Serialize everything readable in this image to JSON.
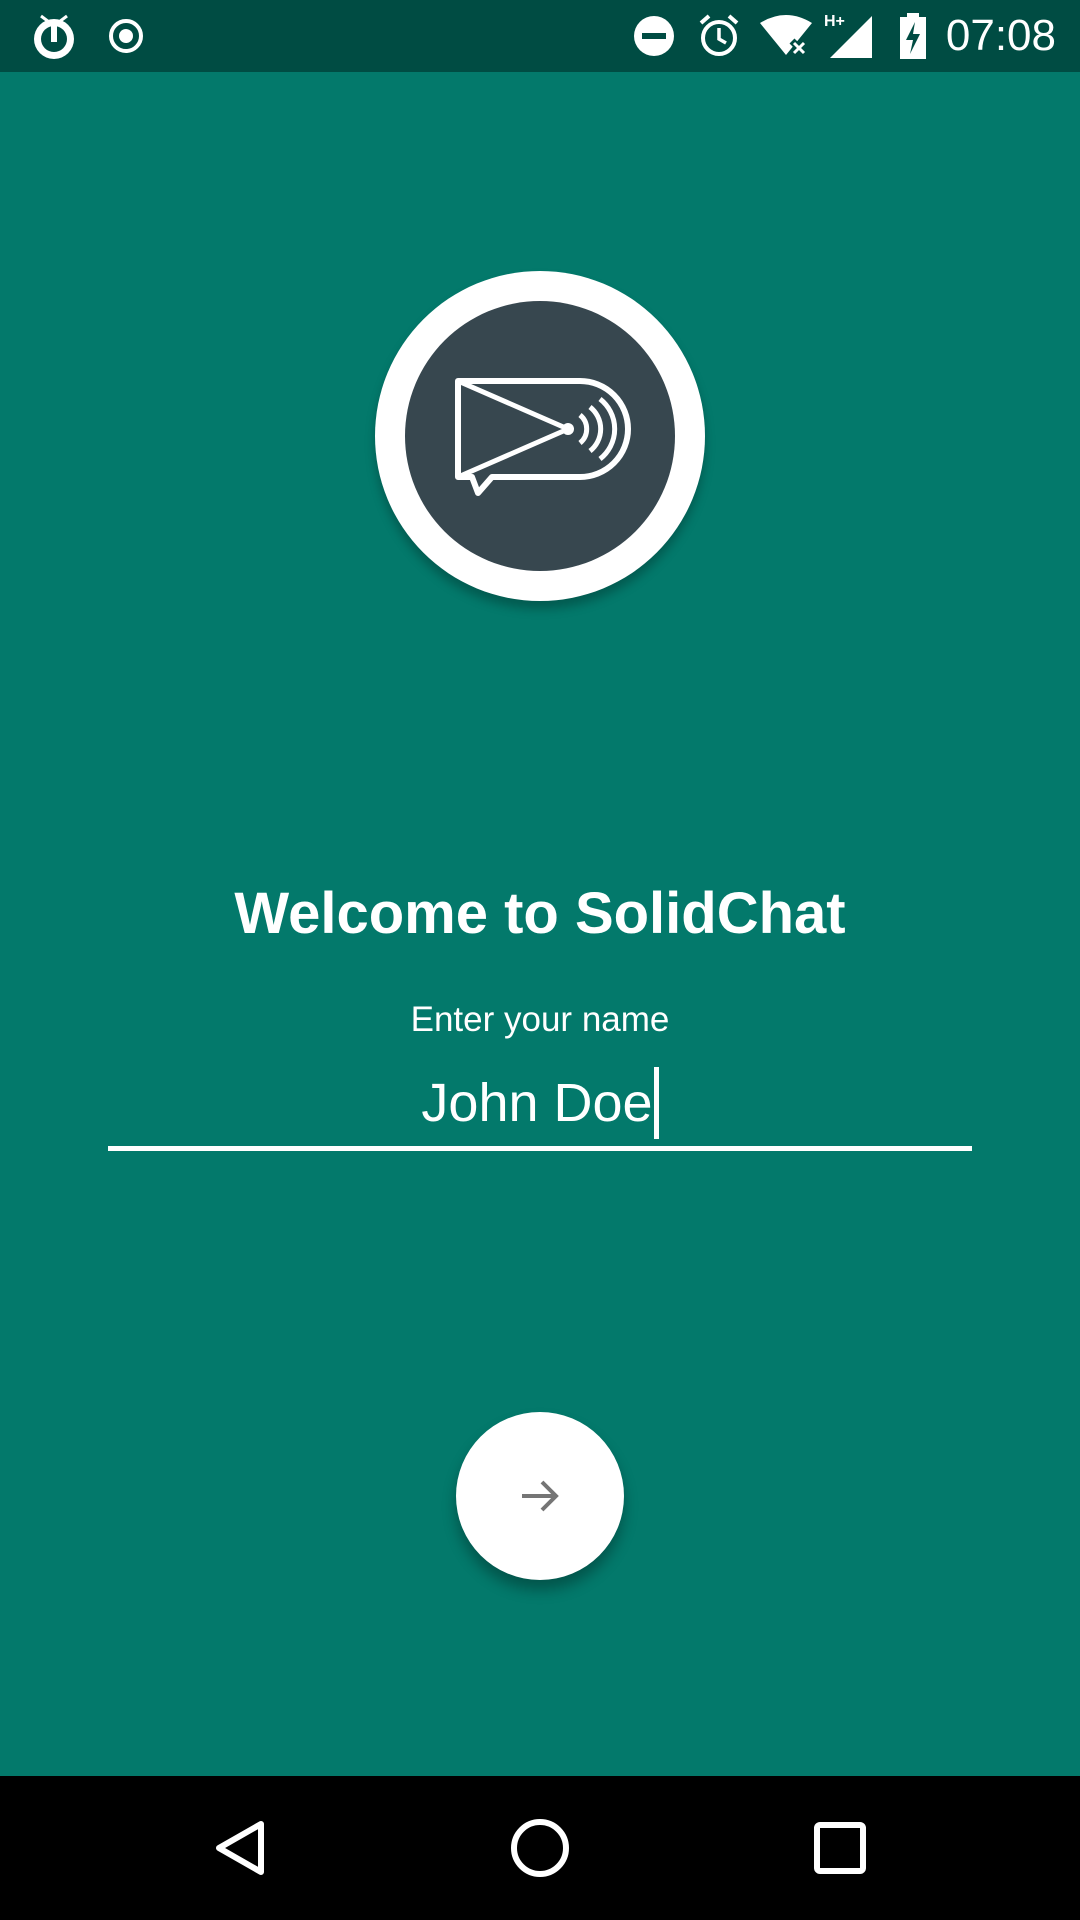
{
  "status_bar": {
    "time": "07:08",
    "network_label": "H+",
    "left_icons": [
      "power-alarm-icon",
      "record-icon"
    ],
    "right_icons": [
      "do-not-disturb-icon",
      "alarm-clock-icon",
      "wifi-off-icon",
      "signal-icon",
      "battery-charging-icon"
    ]
  },
  "welcome": {
    "title": "Welcome to SolidChat",
    "name_label": "Enter your name",
    "name_value": "John Doe"
  },
  "fab": {
    "icon": "arrow-right-icon"
  },
  "nav": {
    "icons": [
      "back-icon",
      "home-icon",
      "recents-icon"
    ]
  },
  "colors": {
    "background": "#03796b",
    "status_bar": "#004c43",
    "logo_inner": "#37474f",
    "nav_bar": "#000000",
    "text": "#ffffff"
  }
}
